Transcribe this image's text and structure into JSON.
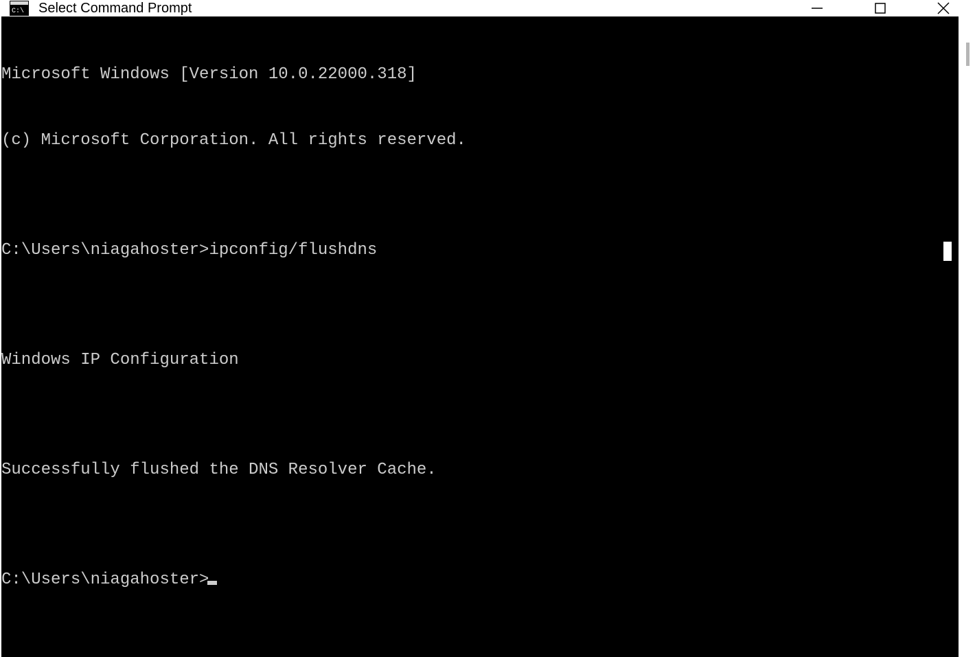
{
  "window": {
    "title": "Select Command Prompt"
  },
  "terminal": {
    "lines": [
      "Microsoft Windows [Version 10.0.22000.318]",
      "(c) Microsoft Corporation. All rights reserved.",
      "",
      "C:\\Users\\niagahoster>ipconfig/flushdns",
      "",
      "Windows IP Configuration",
      "",
      "Successfully flushed the DNS Resolver Cache.",
      ""
    ],
    "prompt": "C:\\Users\\niagahoster>"
  }
}
